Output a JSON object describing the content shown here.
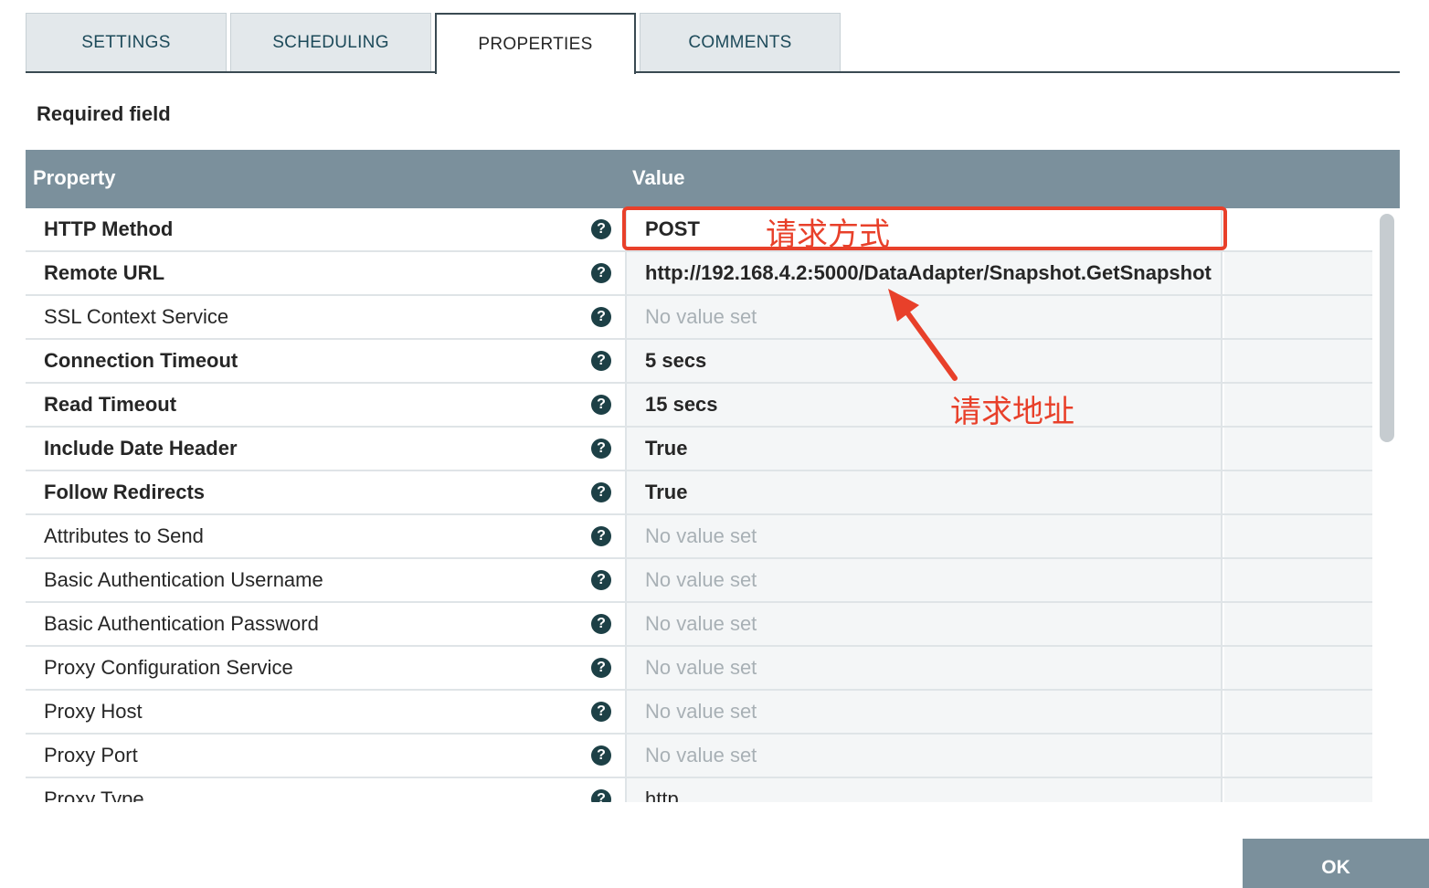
{
  "tabs": [
    {
      "label": "SETTINGS",
      "active": false
    },
    {
      "label": "SCHEDULING",
      "active": false
    },
    {
      "label": "PROPERTIES",
      "active": true
    },
    {
      "label": "COMMENTS",
      "active": false
    }
  ],
  "required_label": "Required field",
  "table": {
    "header_property": "Property",
    "header_value": "Value",
    "help_glyph": "?",
    "rows": [
      {
        "name": "HTTP Method",
        "required": true,
        "value": "POST",
        "empty": false
      },
      {
        "name": "Remote URL",
        "required": true,
        "value": "http://192.168.4.2:5000/DataAdapter/Snapshot.GetSnapshot",
        "empty": false
      },
      {
        "name": "SSL Context Service",
        "required": false,
        "value": "No value set",
        "empty": true
      },
      {
        "name": "Connection Timeout",
        "required": true,
        "value": "5 secs",
        "empty": false
      },
      {
        "name": "Read Timeout",
        "required": true,
        "value": "15 secs",
        "empty": false
      },
      {
        "name": "Include Date Header",
        "required": true,
        "value": "True",
        "empty": false
      },
      {
        "name": "Follow Redirects",
        "required": true,
        "value": "True",
        "empty": false
      },
      {
        "name": "Attributes to Send",
        "required": false,
        "value": "No value set",
        "empty": true
      },
      {
        "name": "Basic Authentication Username",
        "required": false,
        "value": "No value set",
        "empty": true
      },
      {
        "name": "Basic Authentication Password",
        "required": false,
        "value": "No value set",
        "empty": true
      },
      {
        "name": "Proxy Configuration Service",
        "required": false,
        "value": "No value set",
        "empty": true
      },
      {
        "name": "Proxy Host",
        "required": false,
        "value": "No value set",
        "empty": true
      },
      {
        "name": "Proxy Port",
        "required": false,
        "value": "No value set",
        "empty": true
      },
      {
        "name": "Proxy Type",
        "required": false,
        "value": "http",
        "empty": false,
        "plain": true
      }
    ]
  },
  "annotations": {
    "method_note": "请求方式",
    "url_note": "请求地址",
    "color": "#e8402a"
  },
  "ok_label": "OK"
}
